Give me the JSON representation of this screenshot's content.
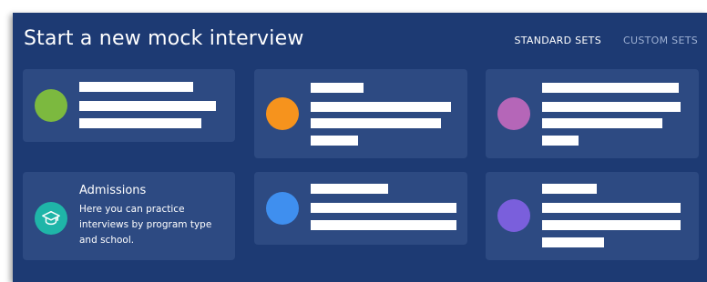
{
  "header": {
    "title": "Start a new mock interview",
    "tabs": [
      {
        "label": "STANDARD SETS",
        "active": true
      },
      {
        "label": "CUSTOM SETS",
        "active": false
      }
    ]
  },
  "cards": [
    {
      "dot_color": "#7cb93f",
      "redacted": true
    },
    {
      "dot_color": "#f6931d",
      "redacted": true
    },
    {
      "dot_color": "#b566b8",
      "redacted": true
    },
    {
      "icon": "graduation-cap-icon",
      "icon_color": "#1fb5a8",
      "title": "Admissions",
      "description": "Here you can practice interviews by program type and school."
    },
    {
      "dot_color": "#3f8fef",
      "redacted": true
    },
    {
      "dot_color": "#7a5fdc",
      "redacted": true
    }
  ],
  "colors": {
    "panel": "#1d3a73",
    "card": "#2d4a82",
    "redaction": "#ffffff"
  }
}
